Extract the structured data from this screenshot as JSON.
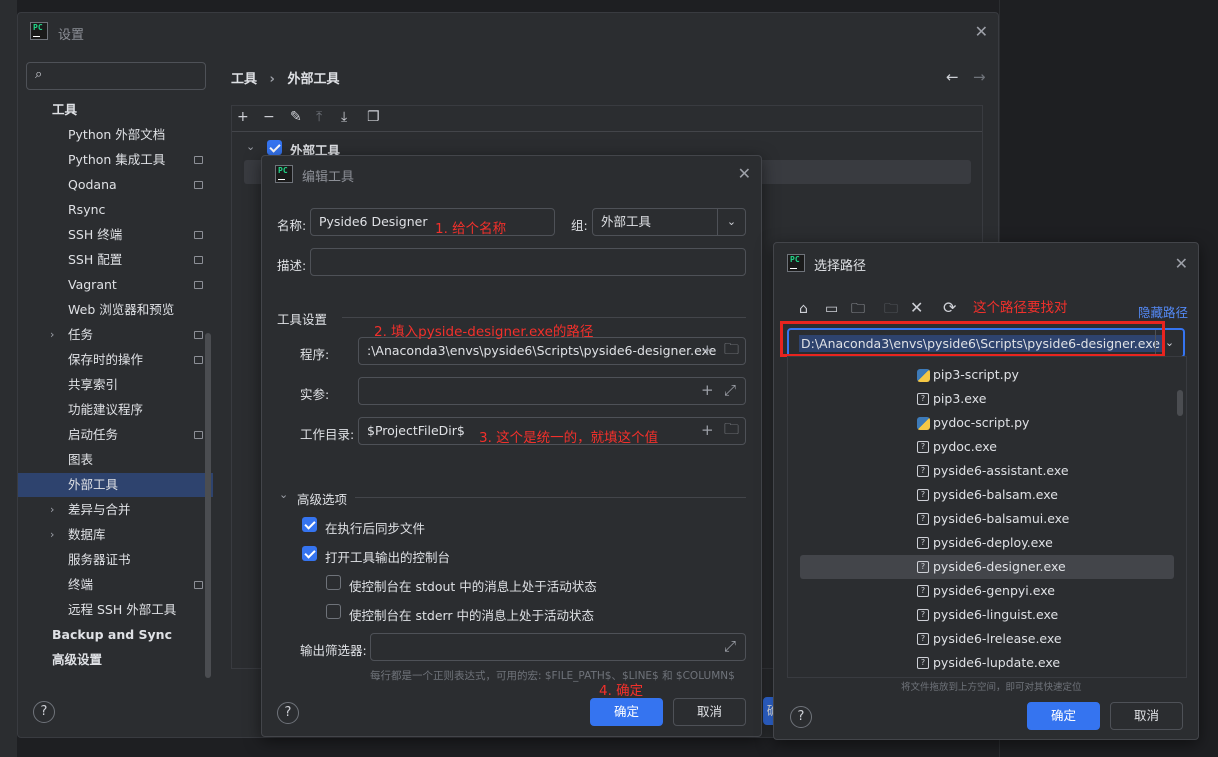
{
  "settings": {
    "title": "设置",
    "search_placeholder": "",
    "breadcrumb": {
      "parent": "工具",
      "sep": "›",
      "current": "外部工具"
    },
    "sidebar": [
      {
        "label": "工具",
        "level": 0,
        "bold": true
      },
      {
        "label": "Python 外部文档",
        "page_icon": false
      },
      {
        "label": "Python 集成工具",
        "page_icon": true
      },
      {
        "label": "Qodana",
        "page_icon": true
      },
      {
        "label": "Rsync",
        "page_icon": false
      },
      {
        "label": "SSH 终端",
        "page_icon": true
      },
      {
        "label": "SSH 配置",
        "page_icon": true
      },
      {
        "label": "Vagrant",
        "page_icon": true
      },
      {
        "label": "Web 浏览器和预览",
        "page_icon": false
      },
      {
        "label": "任务",
        "page_icon": true,
        "expandable": true
      },
      {
        "label": "保存时的操作",
        "page_icon": true
      },
      {
        "label": "共享索引",
        "page_icon": false
      },
      {
        "label": "功能建议程序",
        "page_icon": false
      },
      {
        "label": "启动任务",
        "page_icon": true
      },
      {
        "label": "图表",
        "page_icon": false
      },
      {
        "label": "外部工具",
        "page_icon": false,
        "selected": true
      },
      {
        "label": "差异与合并",
        "page_icon": false,
        "expandable": true
      },
      {
        "label": "数据库",
        "page_icon": false,
        "expandable": true
      },
      {
        "label": "服务器证书",
        "page_icon": false
      },
      {
        "label": "终端",
        "page_icon": true
      },
      {
        "label": "远程 SSH 外部工具",
        "page_icon": false
      },
      {
        "label": "Backup and Sync",
        "level": 0,
        "bold": true
      },
      {
        "label": "高级设置",
        "level": 0,
        "bold": true
      }
    ],
    "tree_group_label": "外部工具",
    "help": "?"
  },
  "edit_tool": {
    "title": "编辑工具",
    "name_label": "名称:",
    "name_value": "Pyside6 Designer",
    "group_label": "组:",
    "group_value": "外部工具",
    "desc_label": "描述:",
    "desc_value": "",
    "tool_settings": "工具设置",
    "program_label": "程序:",
    "program_value": ":\\Anaconda3\\envs\\pyside6\\Scripts\\pyside6-designer.exe",
    "args_label": "实参:",
    "args_value": "",
    "workdir_label": "工作目录:",
    "workdir_value": "$ProjectFileDir$",
    "advanced": "高级选项",
    "opt_sync": "在执行后同步文件",
    "opt_console": "打开工具输出的控制台",
    "opt_stdout": "使控制台在 stdout 中的消息上处于活动状态",
    "opt_stderr": "使控制台在 stderr 中的消息上处于活动状态",
    "filter_label": "输出筛选器:",
    "filter_value": "",
    "filter_hint": "每行都是一个正则表达式，可用的宏: $FILE_PATH$、$LINE$ 和 $COLUMN$",
    "ok": "确定",
    "cancel": "取消",
    "help": "?"
  },
  "annotations": {
    "a1": "1. 给个名称",
    "a2": "2. 填入pyside-designer.exe的路径",
    "a3": "3. 这个是统一的，就填这个值",
    "a4": "4. 确定",
    "a5": "这个路径要找对"
  },
  "path_dialog": {
    "title": "选择路径",
    "hide_path": "隐藏路径",
    "path_value": "D:\\Anaconda3\\envs\\pyside6\\Scripts\\pyside6-designer.exe",
    "files": [
      {
        "name": "pip3-script.py",
        "type": "py"
      },
      {
        "name": "pip3.exe",
        "type": "exe"
      },
      {
        "name": "pydoc-script.py",
        "type": "py"
      },
      {
        "name": "pydoc.exe",
        "type": "exe"
      },
      {
        "name": "pyside6-assistant.exe",
        "type": "exe"
      },
      {
        "name": "pyside6-balsam.exe",
        "type": "exe"
      },
      {
        "name": "pyside6-balsamui.exe",
        "type": "exe"
      },
      {
        "name": "pyside6-deploy.exe",
        "type": "exe"
      },
      {
        "name": "pyside6-designer.exe",
        "type": "exe",
        "selected": true
      },
      {
        "name": "pyside6-genpyi.exe",
        "type": "exe"
      },
      {
        "name": "pyside6-linguist.exe",
        "type": "exe"
      },
      {
        "name": "pyside6-lrelease.exe",
        "type": "exe"
      },
      {
        "name": "pyside6-lupdate.exe",
        "type": "exe"
      }
    ],
    "drop_hint": "将文件拖放到上方空间，即可对其快速定位",
    "ok": "确定",
    "cancel": "取消",
    "help": "?"
  },
  "colors": {
    "accent": "#3574f0",
    "annotation_red": "#f2302b",
    "selection": "#2e436e"
  }
}
